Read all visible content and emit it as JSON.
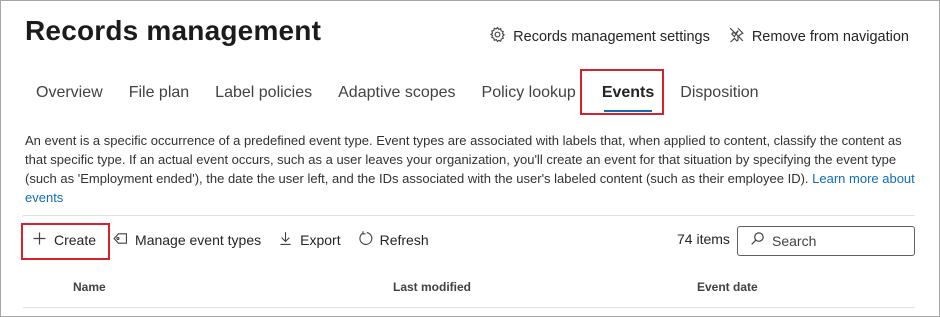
{
  "header": {
    "title": "Records management",
    "settings_label": "Records management settings",
    "remove_nav_label": "Remove from navigation"
  },
  "tabs": [
    {
      "label": "Overview"
    },
    {
      "label": "File plan"
    },
    {
      "label": "Label policies"
    },
    {
      "label": "Adaptive scopes"
    },
    {
      "label": "Policy lookup"
    },
    {
      "label": "Events",
      "active": true
    },
    {
      "label": "Disposition"
    }
  ],
  "description": {
    "text": "An event is a specific occurrence of a predefined event type. Event types are associated with labels that, when applied to content, classify the content as that specific type. If an actual event occurs, such as a user leaves your organization, you'll create an event for that situation by specifying the event type (such as 'Employment ended'), the date the user left, and the IDs associated with the user's labeled content (such as their employee ID).",
    "link": "Learn more about events"
  },
  "toolbar": {
    "create_label": "Create",
    "manage_label": "Manage event types",
    "export_label": "Export",
    "refresh_label": "Refresh",
    "item_count": "74 items"
  },
  "search": {
    "placeholder": "Search",
    "value": ""
  },
  "table": {
    "columns": [
      "Name",
      "Last modified",
      "Event date"
    ]
  },
  "colors": {
    "accent": "#0f6cbd",
    "highlight": "#d6222d"
  }
}
